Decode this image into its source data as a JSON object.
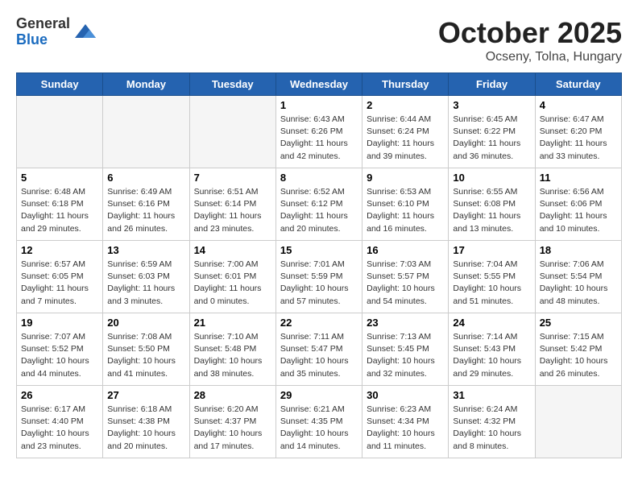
{
  "logo": {
    "general": "General",
    "blue": "Blue"
  },
  "header": {
    "month": "October 2025",
    "location": "Ocseny, Tolna, Hungary"
  },
  "weekdays": [
    "Sunday",
    "Monday",
    "Tuesday",
    "Wednesday",
    "Thursday",
    "Friday",
    "Saturday"
  ],
  "weeks": [
    [
      {
        "day": "",
        "info": ""
      },
      {
        "day": "",
        "info": ""
      },
      {
        "day": "",
        "info": ""
      },
      {
        "day": "1",
        "info": "Sunrise: 6:43 AM\nSunset: 6:26 PM\nDaylight: 11 hours\nand 42 minutes."
      },
      {
        "day": "2",
        "info": "Sunrise: 6:44 AM\nSunset: 6:24 PM\nDaylight: 11 hours\nand 39 minutes."
      },
      {
        "day": "3",
        "info": "Sunrise: 6:45 AM\nSunset: 6:22 PM\nDaylight: 11 hours\nand 36 minutes."
      },
      {
        "day": "4",
        "info": "Sunrise: 6:47 AM\nSunset: 6:20 PM\nDaylight: 11 hours\nand 33 minutes."
      }
    ],
    [
      {
        "day": "5",
        "info": "Sunrise: 6:48 AM\nSunset: 6:18 PM\nDaylight: 11 hours\nand 29 minutes."
      },
      {
        "day": "6",
        "info": "Sunrise: 6:49 AM\nSunset: 6:16 PM\nDaylight: 11 hours\nand 26 minutes."
      },
      {
        "day": "7",
        "info": "Sunrise: 6:51 AM\nSunset: 6:14 PM\nDaylight: 11 hours\nand 23 minutes."
      },
      {
        "day": "8",
        "info": "Sunrise: 6:52 AM\nSunset: 6:12 PM\nDaylight: 11 hours\nand 20 minutes."
      },
      {
        "day": "9",
        "info": "Sunrise: 6:53 AM\nSunset: 6:10 PM\nDaylight: 11 hours\nand 16 minutes."
      },
      {
        "day": "10",
        "info": "Sunrise: 6:55 AM\nSunset: 6:08 PM\nDaylight: 11 hours\nand 13 minutes."
      },
      {
        "day": "11",
        "info": "Sunrise: 6:56 AM\nSunset: 6:06 PM\nDaylight: 11 hours\nand 10 minutes."
      }
    ],
    [
      {
        "day": "12",
        "info": "Sunrise: 6:57 AM\nSunset: 6:05 PM\nDaylight: 11 hours\nand 7 minutes."
      },
      {
        "day": "13",
        "info": "Sunrise: 6:59 AM\nSunset: 6:03 PM\nDaylight: 11 hours\nand 3 minutes."
      },
      {
        "day": "14",
        "info": "Sunrise: 7:00 AM\nSunset: 6:01 PM\nDaylight: 11 hours\nand 0 minutes."
      },
      {
        "day": "15",
        "info": "Sunrise: 7:01 AM\nSunset: 5:59 PM\nDaylight: 10 hours\nand 57 minutes."
      },
      {
        "day": "16",
        "info": "Sunrise: 7:03 AM\nSunset: 5:57 PM\nDaylight: 10 hours\nand 54 minutes."
      },
      {
        "day": "17",
        "info": "Sunrise: 7:04 AM\nSunset: 5:55 PM\nDaylight: 10 hours\nand 51 minutes."
      },
      {
        "day": "18",
        "info": "Sunrise: 7:06 AM\nSunset: 5:54 PM\nDaylight: 10 hours\nand 48 minutes."
      }
    ],
    [
      {
        "day": "19",
        "info": "Sunrise: 7:07 AM\nSunset: 5:52 PM\nDaylight: 10 hours\nand 44 minutes."
      },
      {
        "day": "20",
        "info": "Sunrise: 7:08 AM\nSunset: 5:50 PM\nDaylight: 10 hours\nand 41 minutes."
      },
      {
        "day": "21",
        "info": "Sunrise: 7:10 AM\nSunset: 5:48 PM\nDaylight: 10 hours\nand 38 minutes."
      },
      {
        "day": "22",
        "info": "Sunrise: 7:11 AM\nSunset: 5:47 PM\nDaylight: 10 hours\nand 35 minutes."
      },
      {
        "day": "23",
        "info": "Sunrise: 7:13 AM\nSunset: 5:45 PM\nDaylight: 10 hours\nand 32 minutes."
      },
      {
        "day": "24",
        "info": "Sunrise: 7:14 AM\nSunset: 5:43 PM\nDaylight: 10 hours\nand 29 minutes."
      },
      {
        "day": "25",
        "info": "Sunrise: 7:15 AM\nSunset: 5:42 PM\nDaylight: 10 hours\nand 26 minutes."
      }
    ],
    [
      {
        "day": "26",
        "info": "Sunrise: 6:17 AM\nSunset: 4:40 PM\nDaylight: 10 hours\nand 23 minutes."
      },
      {
        "day": "27",
        "info": "Sunrise: 6:18 AM\nSunset: 4:38 PM\nDaylight: 10 hours\nand 20 minutes."
      },
      {
        "day": "28",
        "info": "Sunrise: 6:20 AM\nSunset: 4:37 PM\nDaylight: 10 hours\nand 17 minutes."
      },
      {
        "day": "29",
        "info": "Sunrise: 6:21 AM\nSunset: 4:35 PM\nDaylight: 10 hours\nand 14 minutes."
      },
      {
        "day": "30",
        "info": "Sunrise: 6:23 AM\nSunset: 4:34 PM\nDaylight: 10 hours\nand 11 minutes."
      },
      {
        "day": "31",
        "info": "Sunrise: 6:24 AM\nSunset: 4:32 PM\nDaylight: 10 hours\nand 8 minutes."
      },
      {
        "day": "",
        "info": ""
      }
    ]
  ]
}
